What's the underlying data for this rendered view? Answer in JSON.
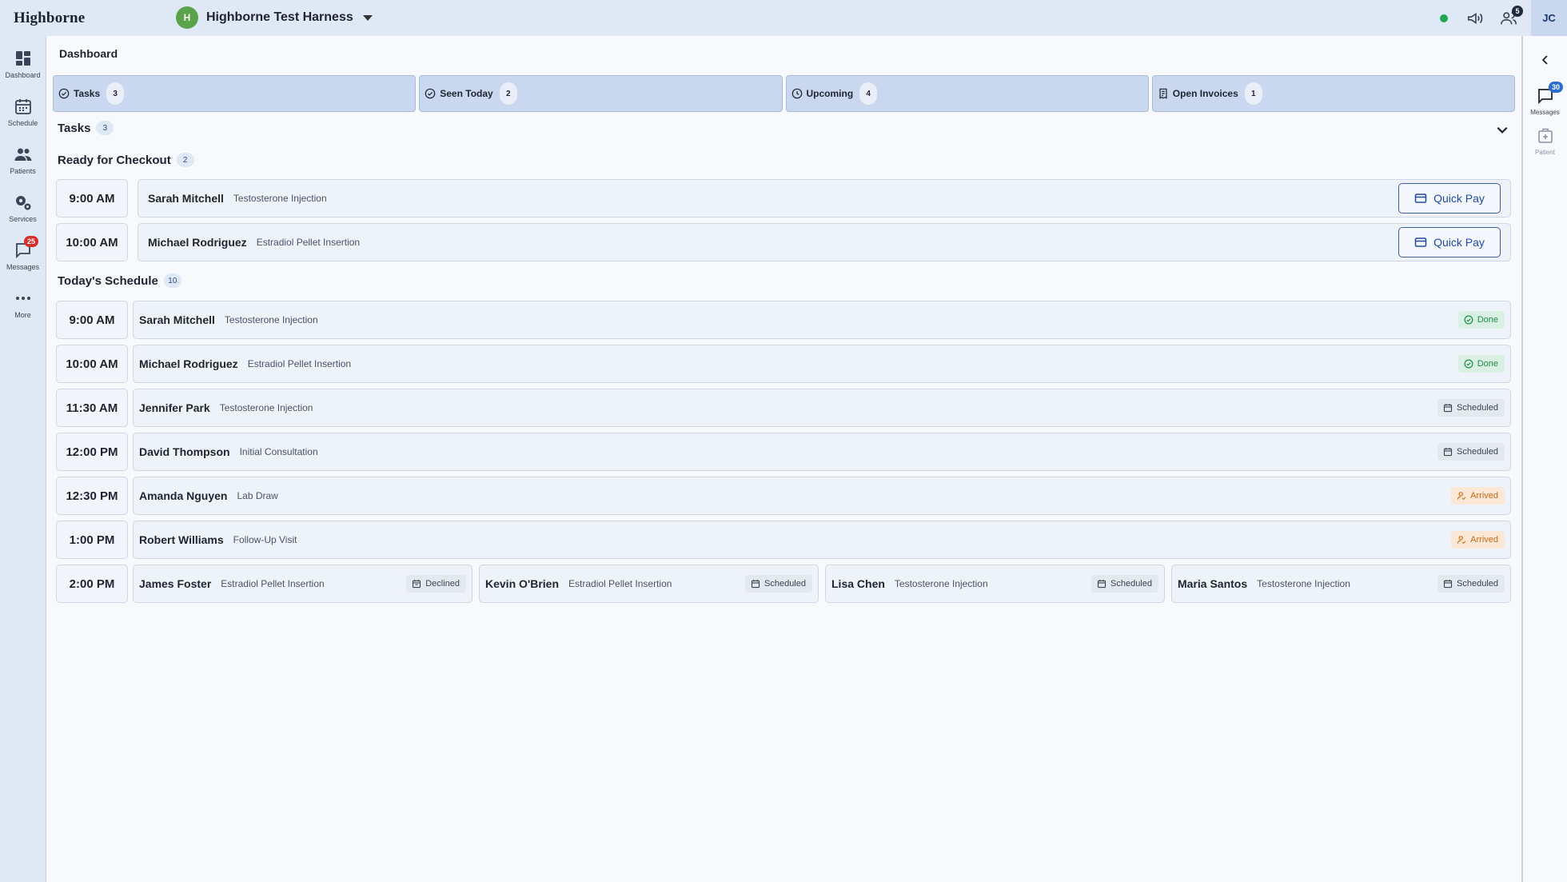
{
  "app": {
    "logo": "Highborne",
    "org_avatar": "H",
    "org_name": "Highborne Test Harness",
    "user_initials": "JC",
    "announcements_icon": "megaphone-icon",
    "people_badge": "5"
  },
  "nav": {
    "items": [
      {
        "label": "Dashboard",
        "icon": "dashboard-icon"
      },
      {
        "label": "Schedule",
        "icon": "calendar-icon"
      },
      {
        "label": "Patients",
        "icon": "patients-icon"
      },
      {
        "label": "Services",
        "icon": "gear-icon"
      },
      {
        "label": "Messages",
        "icon": "chat-icon",
        "badge": "25"
      },
      {
        "label": "More",
        "icon": "more-icon"
      }
    ]
  },
  "rightrail": {
    "messages_label": "Messages",
    "messages_badge": "30",
    "patient_label": "Patient"
  },
  "page": {
    "title": "Dashboard"
  },
  "tabs": [
    {
      "label": "Tasks",
      "count": "3",
      "icon": "check-circle-icon"
    },
    {
      "label": "Seen Today",
      "count": "2",
      "icon": "check-circle-icon"
    },
    {
      "label": "Upcoming",
      "count": "4",
      "icon": "clock-icon"
    },
    {
      "label": "Open Invoices",
      "count": "1",
      "icon": "invoice-icon"
    }
  ],
  "tasks_section": {
    "title": "Tasks",
    "count": "3"
  },
  "checkout": {
    "title": "Ready for Checkout",
    "count": "2",
    "quick_pay_label": "Quick Pay",
    "rows": [
      {
        "time": "9:00 AM",
        "name": "Sarah Mitchell",
        "service": "Testosterone Injection"
      },
      {
        "time": "10:00 AM",
        "name": "Michael Rodriguez",
        "service": "Estradiol Pellet Insertion"
      }
    ]
  },
  "schedule": {
    "title": "Today's Schedule",
    "count": "10",
    "rows": [
      {
        "time": "9:00 AM",
        "items": [
          {
            "name": "Sarah Mitchell",
            "service": "Testosterone Injection",
            "status": "Done"
          }
        ]
      },
      {
        "time": "10:00 AM",
        "items": [
          {
            "name": "Michael Rodriguez",
            "service": "Estradiol Pellet Insertion",
            "status": "Done"
          }
        ]
      },
      {
        "time": "11:30 AM",
        "items": [
          {
            "name": "Jennifer Park",
            "service": "Testosterone Injection",
            "status": "Scheduled"
          }
        ]
      },
      {
        "time": "12:00 PM",
        "items": [
          {
            "name": "David Thompson",
            "service": "Initial Consultation",
            "status": "Scheduled"
          }
        ]
      },
      {
        "time": "12:30 PM",
        "items": [
          {
            "name": "Amanda Nguyen",
            "service": "Lab Draw",
            "status": "Arrived"
          }
        ]
      },
      {
        "time": "1:00 PM",
        "items": [
          {
            "name": "Robert Williams",
            "service": "Follow-Up Visit",
            "status": "Arrived"
          }
        ]
      },
      {
        "time": "2:00 PM",
        "items": [
          {
            "name": "James Foster",
            "service": "Estradiol Pellet Insertion",
            "status": "Declined"
          },
          {
            "name": "Kevin O'Brien",
            "service": "Estradiol Pellet Insertion",
            "status": "Scheduled"
          },
          {
            "name": "Lisa Chen",
            "service": "Testosterone Injection",
            "status": "Scheduled"
          },
          {
            "name": "Maria Santos",
            "service": "Testosterone Injection",
            "status": "Scheduled"
          }
        ]
      }
    ]
  },
  "colors": {
    "nav_bg": "#dfe8f5",
    "tab_bg": "#c9d8ee",
    "done": "#1e8c4a",
    "arrived": "#c96a18",
    "accent": "#1f4aa0",
    "alert_badge": "#d62d2d"
  }
}
